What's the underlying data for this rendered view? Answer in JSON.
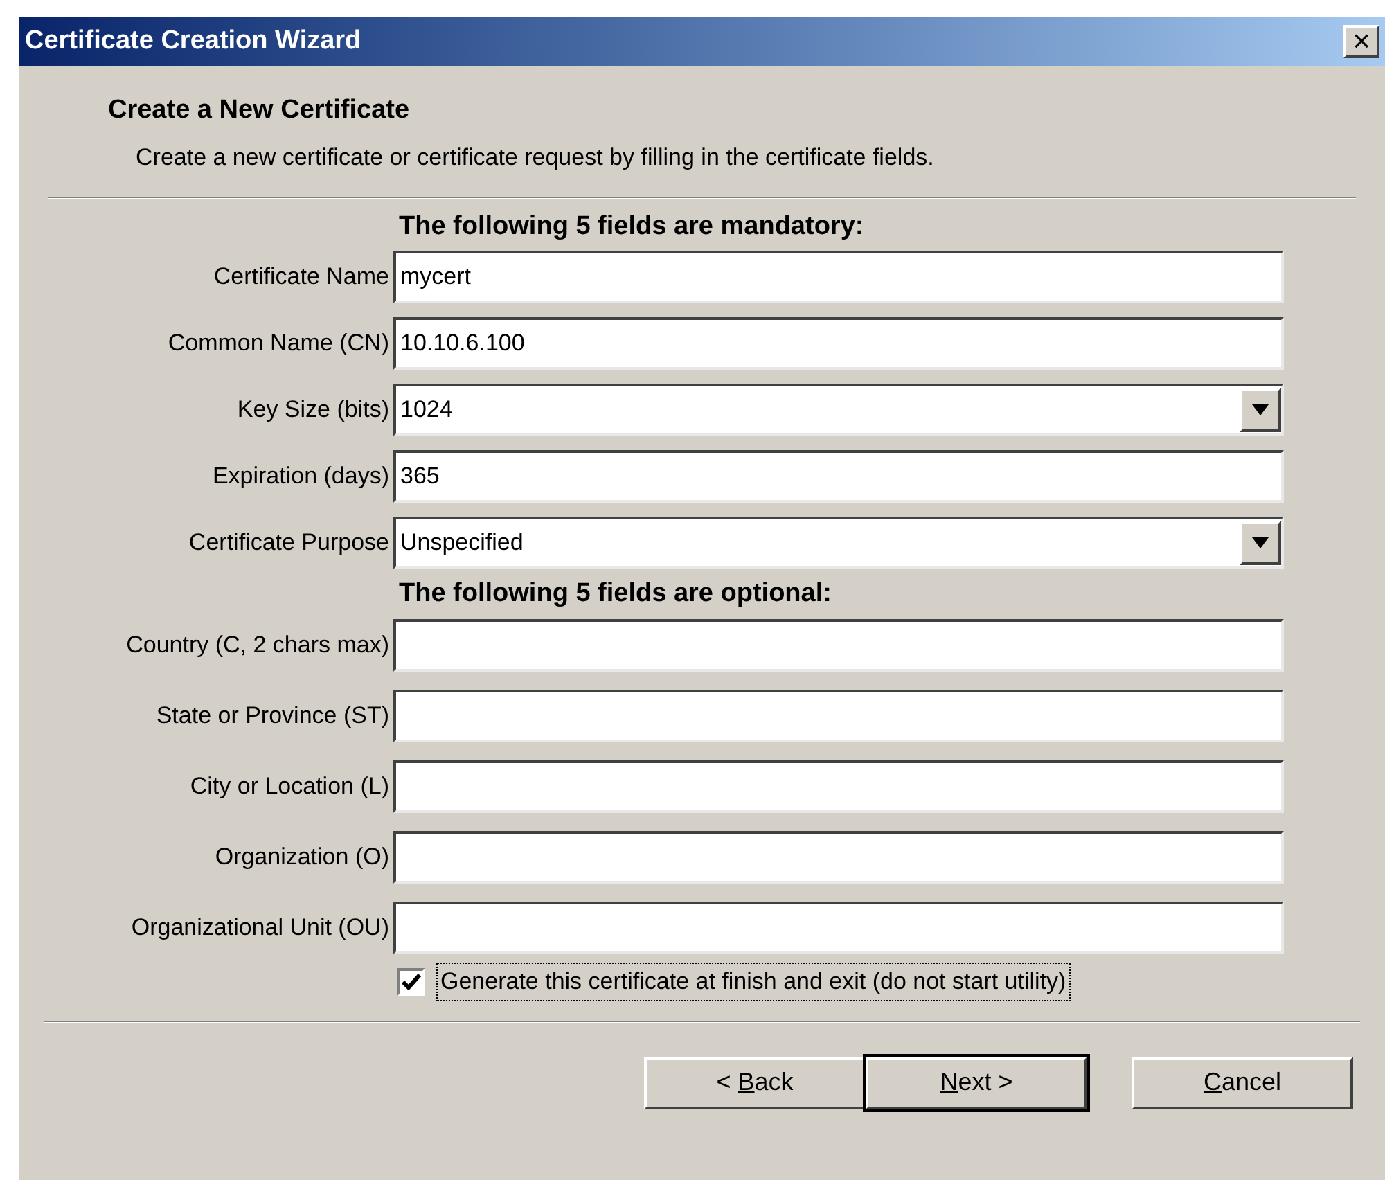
{
  "window": {
    "title": "Certificate Creation Wizard",
    "close": "×"
  },
  "header": {
    "title": "Create a New Certificate",
    "subtitle": "Create a new certificate or certificate request by filling in the certificate fields."
  },
  "sections": [
    {
      "heading": "The following 5 fields are mandatory:",
      "fields": [
        {
          "kind": "text",
          "label": "Certificate Name",
          "value": "mycert"
        },
        {
          "kind": "text",
          "label": "Common Name (CN)",
          "value": "10.10.6.100"
        },
        {
          "kind": "dropdown",
          "label": "Key Size (bits)",
          "value": "1024"
        },
        {
          "kind": "text",
          "label": "Expiration (days)",
          "value": "365"
        },
        {
          "kind": "dropdown",
          "label": "Certificate Purpose",
          "value": "Unspecified"
        }
      ]
    },
    {
      "heading": "The following 5 fields are optional:",
      "fields": [
        {
          "kind": "text",
          "label": "Country (C, 2 chars max)"
        },
        {
          "kind": "text",
          "label": "State or Province (ST)"
        },
        {
          "kind": "text",
          "label": "City or Location (L)"
        },
        {
          "kind": "text",
          "label": "Organization (O)"
        },
        {
          "kind": "text",
          "label": "Organizational Unit (OU)"
        }
      ]
    }
  ],
  "checkbox": {
    "label": "Generate this certificate at finish and exit (do not start utility)",
    "checked": true
  },
  "buttons": [
    {
      "pre": "< ",
      "key": "B",
      "post": "ack",
      "default": false
    },
    {
      "key": "N",
      "post": "ext >",
      "default": true
    },
    {
      "key": "C",
      "post": "ancel",
      "default": false
    }
  ]
}
